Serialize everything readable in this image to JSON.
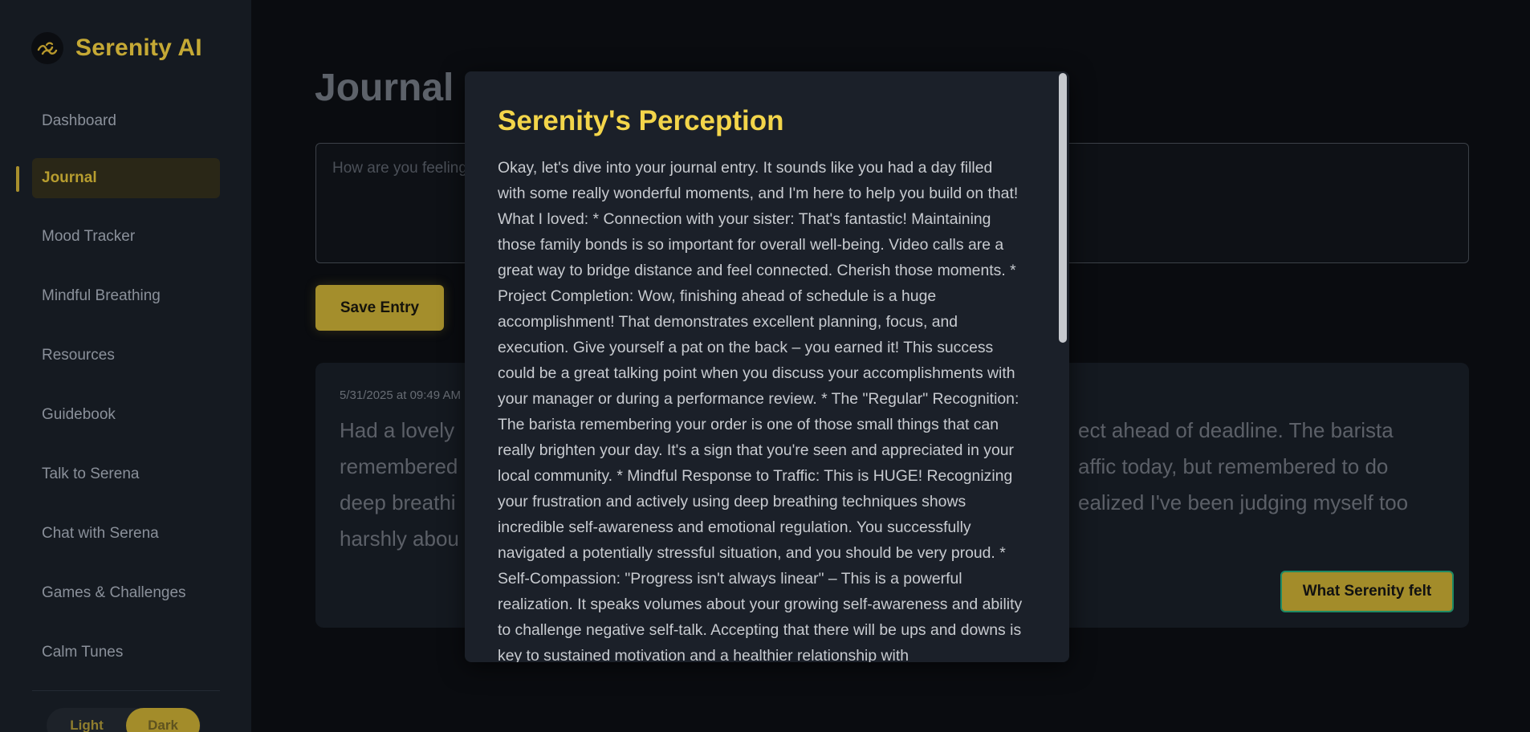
{
  "app": {
    "name": "Serenity AI",
    "logo_icon": "wave-icon",
    "accent_color": "#c5a935"
  },
  "sidebar": {
    "items": [
      {
        "label": "Dashboard",
        "active": false
      },
      {
        "label": "Journal",
        "active": true
      },
      {
        "label": "Mood Tracker",
        "active": false
      },
      {
        "label": "Mindful Breathing",
        "active": false
      },
      {
        "label": "Resources",
        "active": false
      },
      {
        "label": "Guidebook",
        "active": false
      },
      {
        "label": "Talk to Serena",
        "active": false
      },
      {
        "label": "Chat with Serena",
        "active": false
      },
      {
        "label": "Games & Challenges",
        "active": false
      },
      {
        "label": "Calm Tunes",
        "active": false
      }
    ],
    "theme": {
      "light_label": "Light",
      "dark_label": "Dark",
      "selected": "Dark"
    }
  },
  "main": {
    "title": "Journal",
    "input_placeholder": "How are you feeling today?",
    "input_visible_text": "How are you feelin",
    "save_label": "Save Entry",
    "entry": {
      "date": "5/31/2025 at 09:49 AM",
      "text_left": "Had a lovely\nremembered\ndeep breathi\nharshly abou",
      "text_right": "ect ahead of deadline. The barista\naffic today, but remembered to do\nealized I've been judging myself too",
      "felt_label": "What Serenity felt"
    }
  },
  "modal": {
    "title": "Serenity's Perception",
    "body": "Okay, let's dive into your journal entry. It sounds like you had a day filled with some really wonderful moments, and I'm here to help you build on that! What I loved: * Connection with your sister: That's fantastic! Maintaining those family bonds is so important for overall well-being. Video calls are a great way to bridge distance and feel connected. Cherish those moments. * Project Completion: Wow, finishing ahead of schedule is a huge accomplishment! That demonstrates excellent planning, focus, and execution. Give yourself a pat on the back – you earned it! This success could be a great talking point when you discuss your accomplishments with your manager or during a performance review. * The \"Regular\" Recognition: The barista remembering your order is one of those small things that can really brighten your day. It's a sign that you're seen and appreciated in your local community. * Mindful Response to Traffic: This is HUGE! Recognizing your frustration and actively using deep breathing techniques shows incredible self-awareness and emotional regulation. You successfully navigated a potentially stressful situation, and you should be very proud. * Self-Compassion: \"Progress isn't always linear\" – This is a powerful realization. It speaks volumes about your growing self-awareness and ability to challenge negative self-talk. Accepting that there will be ups and downs is key to sustained motivation and a healthier relationship with"
  }
}
